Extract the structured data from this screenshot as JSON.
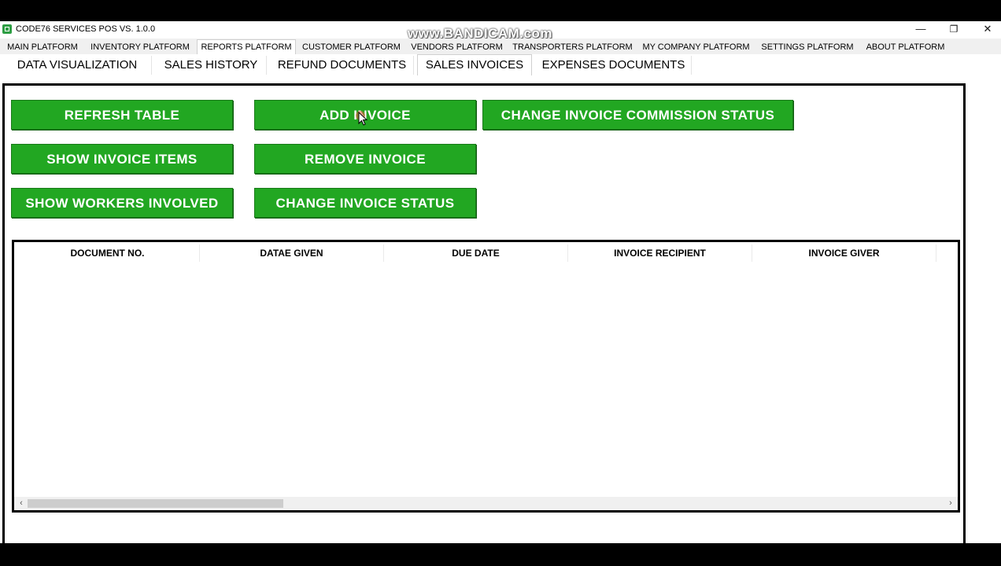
{
  "window": {
    "title": "CODE76 SERVICES POS VS. 1.0.0",
    "watermark": "www.BANDICAM.com",
    "controls": {
      "minimize": "—",
      "restore": "❐",
      "close": "✕"
    }
  },
  "top_tabs": [
    {
      "label": "MAIN PLATFORM"
    },
    {
      "label": "INVENTORY PLATFORM"
    },
    {
      "label": "REPORTS PLATFORM",
      "active": true
    },
    {
      "label": "CUSTOMER PLATFORM"
    },
    {
      "label": "VENDORS PLATFORM"
    },
    {
      "label": "TRANSPORTERS PLATFORM"
    },
    {
      "label": "MY COMPANY PLATFORM"
    },
    {
      "label": "SETTINGS PLATFORM"
    },
    {
      "label": "ABOUT PLATFORM"
    }
  ],
  "sub_tabs": [
    {
      "label": "DATA VISUALIZATION"
    },
    {
      "label": "SALES HISTORY"
    },
    {
      "label": "REFUND DOCUMENTS"
    },
    {
      "label": "SALES INVOICES",
      "active": true
    },
    {
      "label": "EXPENSES DOCUMENTS"
    }
  ],
  "actions": {
    "refresh_table": "REFRESH TABLE",
    "show_invoice_items": "SHOW INVOICE ITEMS",
    "show_workers_involved": "SHOW WORKERS INVOLVED",
    "add_invoice": "ADD  INVOICE",
    "remove_invoice": "REMOVE  INVOICE",
    "change_invoice_status": "CHANGE INVOICE STATUS",
    "change_commission_status": "CHANGE INVOICE COMMISSION STATUS"
  },
  "table": {
    "columns": [
      "DOCUMENT NO.",
      "DATAE GIVEN",
      "DUE DATE",
      "INVOICE RECIPIENT",
      "INVOICE GIVER"
    ],
    "rows": [],
    "scroll": {
      "left_arrow": "‹",
      "right_arrow": "›"
    }
  },
  "colors": {
    "button_green": "#22a722",
    "button_text": "#ffffff",
    "background": "#ffffff"
  }
}
